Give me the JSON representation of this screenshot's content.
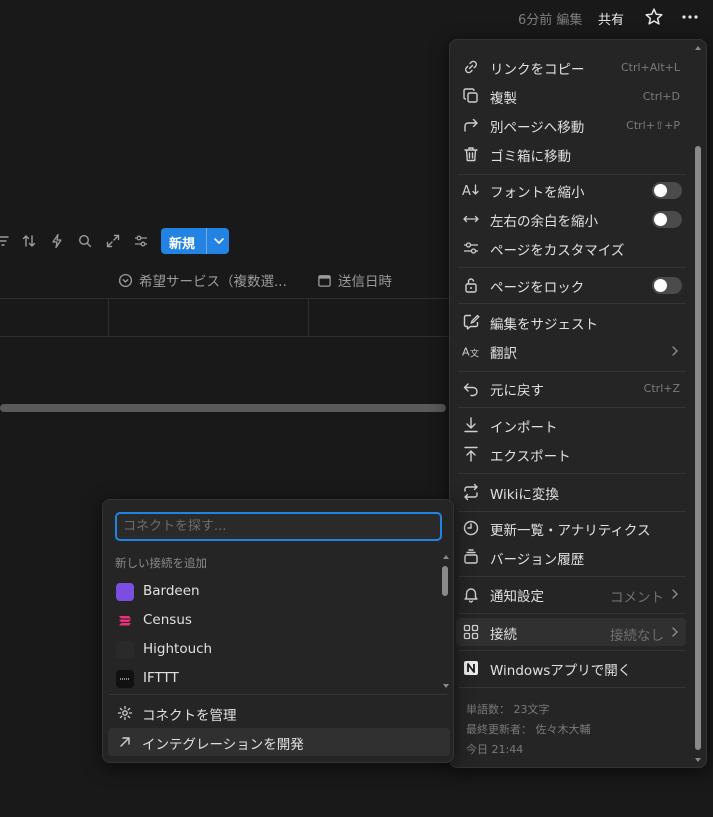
{
  "topbar": {
    "edited": "6分前 編集",
    "share": "共有",
    "favorite_icon": "star-icon",
    "more_icon": "more-horizontal-icon"
  },
  "database": {
    "toolbar_icons": [
      "filter-icon",
      "sort-icon",
      "automation-bolt-icon",
      "search-icon",
      "expand-icon",
      "settings-sliders-icon"
    ],
    "new_button": "新規",
    "columns": [
      {
        "label": "希望サービス（複数選...",
        "icon": "select-circle-icon"
      },
      {
        "label": "送信日時",
        "icon": "calendar-icon"
      }
    ]
  },
  "menu": {
    "items": [
      {
        "label": "リンクをコピー",
        "shortcut": "Ctrl+Alt+L",
        "icon": "link-icon"
      },
      {
        "label": "複製",
        "shortcut": "Ctrl+D",
        "icon": "duplicate-icon"
      },
      {
        "label": "別ページへ移動",
        "shortcut": "Ctrl+⇧+P",
        "icon": "move-arrow-icon"
      },
      {
        "label": "ゴミ箱に移動",
        "icon": "trash-icon"
      },
      {
        "label": "フォントを縮小",
        "icon": "font-size-icon",
        "toggle": false
      },
      {
        "label": "左右の余白を縮小",
        "icon": "full-width-icon",
        "toggle": false
      },
      {
        "label": "ページをカスタマイズ",
        "icon": "customize-sliders-icon"
      },
      {
        "label": "ページをロック",
        "icon": "lock-icon",
        "toggle": false
      },
      {
        "label": "編集をサジェスト",
        "icon": "suggest-edit-icon"
      },
      {
        "label": "翻訳",
        "icon": "translate-icon"
      },
      {
        "label": "元に戻す",
        "shortcut": "Ctrl+Z",
        "icon": "undo-icon"
      },
      {
        "label": "インポート",
        "icon": "import-icon"
      },
      {
        "label": "エクスポート",
        "icon": "export-icon"
      },
      {
        "label": "Wikiに変換",
        "icon": "wiki-convert-icon"
      },
      {
        "label": "更新一覧・アナリティクス",
        "icon": "clock-icon"
      },
      {
        "label": "バージョン履歴",
        "icon": "version-history-icon"
      },
      {
        "label": "通知設定",
        "value": "コメント",
        "icon": "bell-icon"
      },
      {
        "label": "接続",
        "value": "接続なし",
        "icon": "connections-grid-icon"
      },
      {
        "label": "Windowsアプリで開く",
        "icon": "notion-app-icon"
      }
    ],
    "footer": {
      "word_count": "単語数： 23文字",
      "last_editor": "最終更新者： 佐々木大輔",
      "time": "今日 21:44"
    }
  },
  "connect_popup": {
    "search_placeholder": "コネクトを探す...",
    "section_title": "新しい接続を追加",
    "apps": [
      {
        "name": "Bardeen",
        "color": "#7a4fe0"
      },
      {
        "name": "Census",
        "color": "#f0307a"
      },
      {
        "name": "Hightouch",
        "color": "#2a2a2a"
      },
      {
        "name": "IFTTT",
        "color": "#111111"
      }
    ],
    "manage": "コネクトを管理",
    "develop": "インテグレーションを開発"
  },
  "colors": {
    "accent": "#2383e2",
    "background": "#191919",
    "menu_bg": "#252525"
  }
}
